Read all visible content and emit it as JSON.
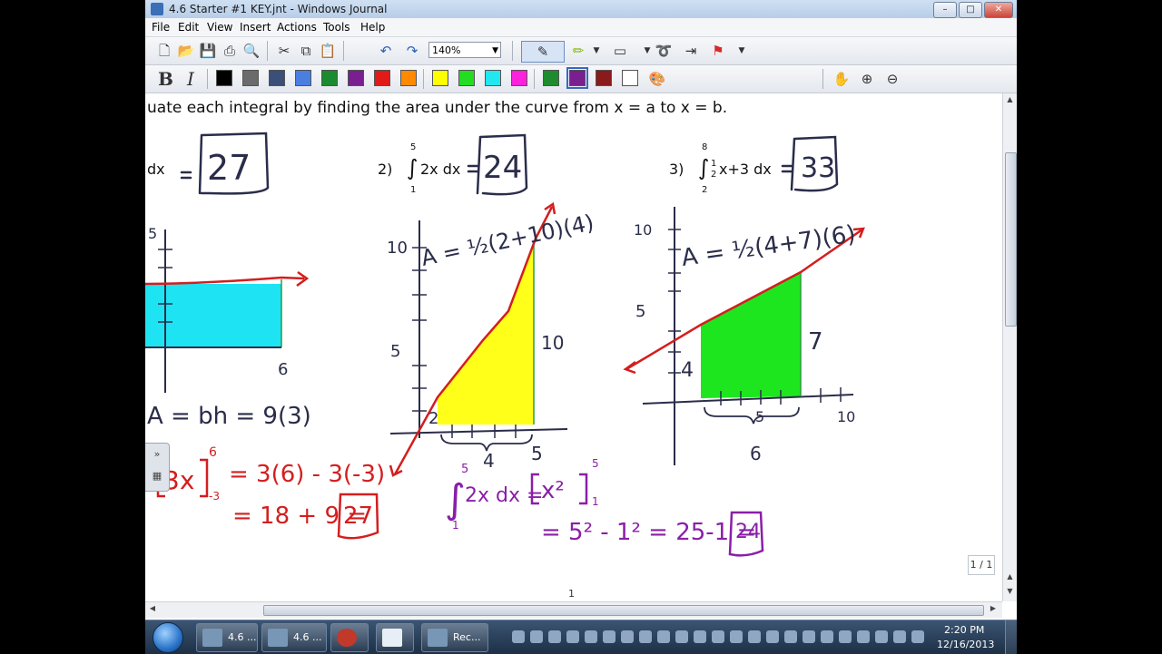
{
  "window": {
    "title": "4.6 Starter #1 KEY.jnt - Windows Journal",
    "min_glyph": "–",
    "max_glyph": "□",
    "close_glyph": "✕"
  },
  "menu": [
    "File",
    "Edit",
    "View",
    "Insert",
    "Actions",
    "Tools",
    "Help"
  ],
  "toolbar": {
    "zoom": "140%",
    "bold": "B",
    "italic": "I",
    "swatches": [
      "#000000",
      "#6b6b6b",
      "#3a4f7a",
      "#4a7fe0",
      "#1c8a2e",
      "#7a1f8f",
      "#e11a1a",
      "#ff8a00",
      "#ffff00",
      "#22dd22",
      "#22e6f0",
      "#ff22dd",
      "#1e8c2e",
      "#7a1f8f",
      "#8b1a1a",
      "#ffffff"
    ]
  },
  "note": {
    "instruction": "uate each integral by finding the area under the curve from x = a to x = b.",
    "problem1": {
      "tail": "dx",
      "answer": "27"
    },
    "problem2": {
      "num": "2)",
      "upper": "5",
      "lower": "1",
      "integrand": "2x dx",
      "answer": "24"
    },
    "problem3": {
      "num": "3)",
      "upper": "8",
      "lower": "2",
      "integrand": "x+3 dx",
      "frac_num": "1",
      "frac_den": "2",
      "answer": "33"
    },
    "hand1": {
      "y_tick": "5",
      "x_tick": "6",
      "area": "A = bh = 9(3)",
      "bracket_inner": "3x",
      "bracket_upper": "6",
      "bracket_lower": "-3",
      "eval1": "= 3(6) - 3(-3)",
      "eval2": "= 18 + 9 =",
      "answer": "27"
    },
    "hand2": {
      "formula": "A = ½(2+10)(4)",
      "y10": "10",
      "y5": "5",
      "side10": "10",
      "side2": "2",
      "base": "4",
      "x5": "5",
      "integral_upper": "5",
      "integral_lower": "1",
      "integral_body": "2x dx =",
      "bracket_body": "x²",
      "bracket_upper": "5",
      "bracket_lower": "1",
      "eval": "= 5² - 1² = 25-1 =",
      "answer": "24"
    },
    "hand3": {
      "formula": "A = ½(4+7)(6)",
      "y10": "10",
      "y5": "5",
      "side4": "4",
      "side7": "7",
      "x5": "5",
      "x10": "10",
      "base": "6"
    },
    "page_count": "1 / 1",
    "page_number": "1"
  },
  "taskbar": {
    "tasks": [
      "4.6 ...",
      "4.6 ...",
      "Rec..."
    ],
    "time": "2:20 PM",
    "date": "12/16/2013"
  }
}
